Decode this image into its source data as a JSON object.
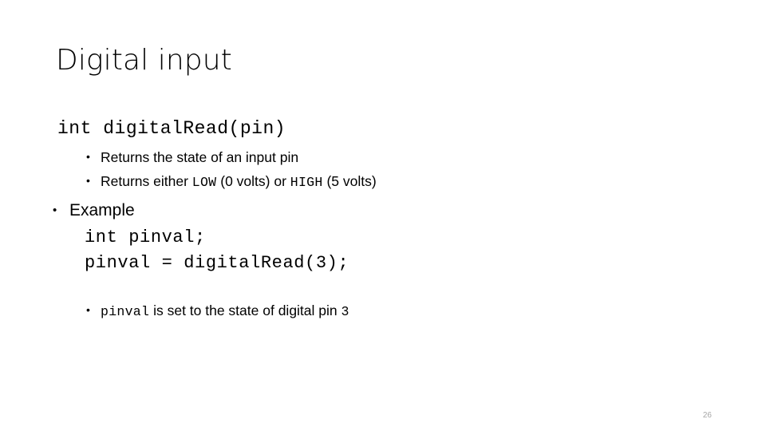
{
  "slide": {
    "title": "Digital input",
    "page_number": "26",
    "page_number_color": "#a6a6a6",
    "background_color": "#ffffff",
    "text_color": "#000000"
  },
  "signature": {
    "code": "int digitalRead(pin)"
  },
  "bullets": [
    {
      "dot": "•",
      "level": 2,
      "parts": [
        {
          "text": "Returns the state of an input pin",
          "style": "text"
        }
      ]
    },
    {
      "dot": "•",
      "level": 2,
      "parts": [
        {
          "text": "Returns either ",
          "style": "text"
        },
        {
          "text": "LOW",
          "style": "mono"
        },
        {
          "text": " (0 volts) or ",
          "style": "text"
        },
        {
          "text": "HIGH",
          "style": "mono"
        },
        {
          "text": " (5 volts)",
          "style": "text"
        }
      ]
    }
  ],
  "example": {
    "dot": "•",
    "label": "Example",
    "code_lines": [
      "int pinval;",
      "pinval = digitalRead(3);"
    ],
    "note": {
      "dot": "•",
      "parts": [
        {
          "text": "pinval",
          "style": "mono"
        },
        {
          "text": " is set to the state of digital pin ",
          "style": "text"
        },
        {
          "text": "3",
          "style": "mono"
        }
      ]
    }
  },
  "bullet_text": {
    "b1_full": "Returns the state of an input pin",
    "b2_prefix": "Returns either ",
    "b2_low": "LOW",
    "b2_mid": " (0 volts) or ",
    "b2_high": "HIGH",
    "b2_suffix": " (5 volts)",
    "note_var": "pinval",
    "note_mid": " is set to the state of digital pin ",
    "note_pin": "3"
  }
}
